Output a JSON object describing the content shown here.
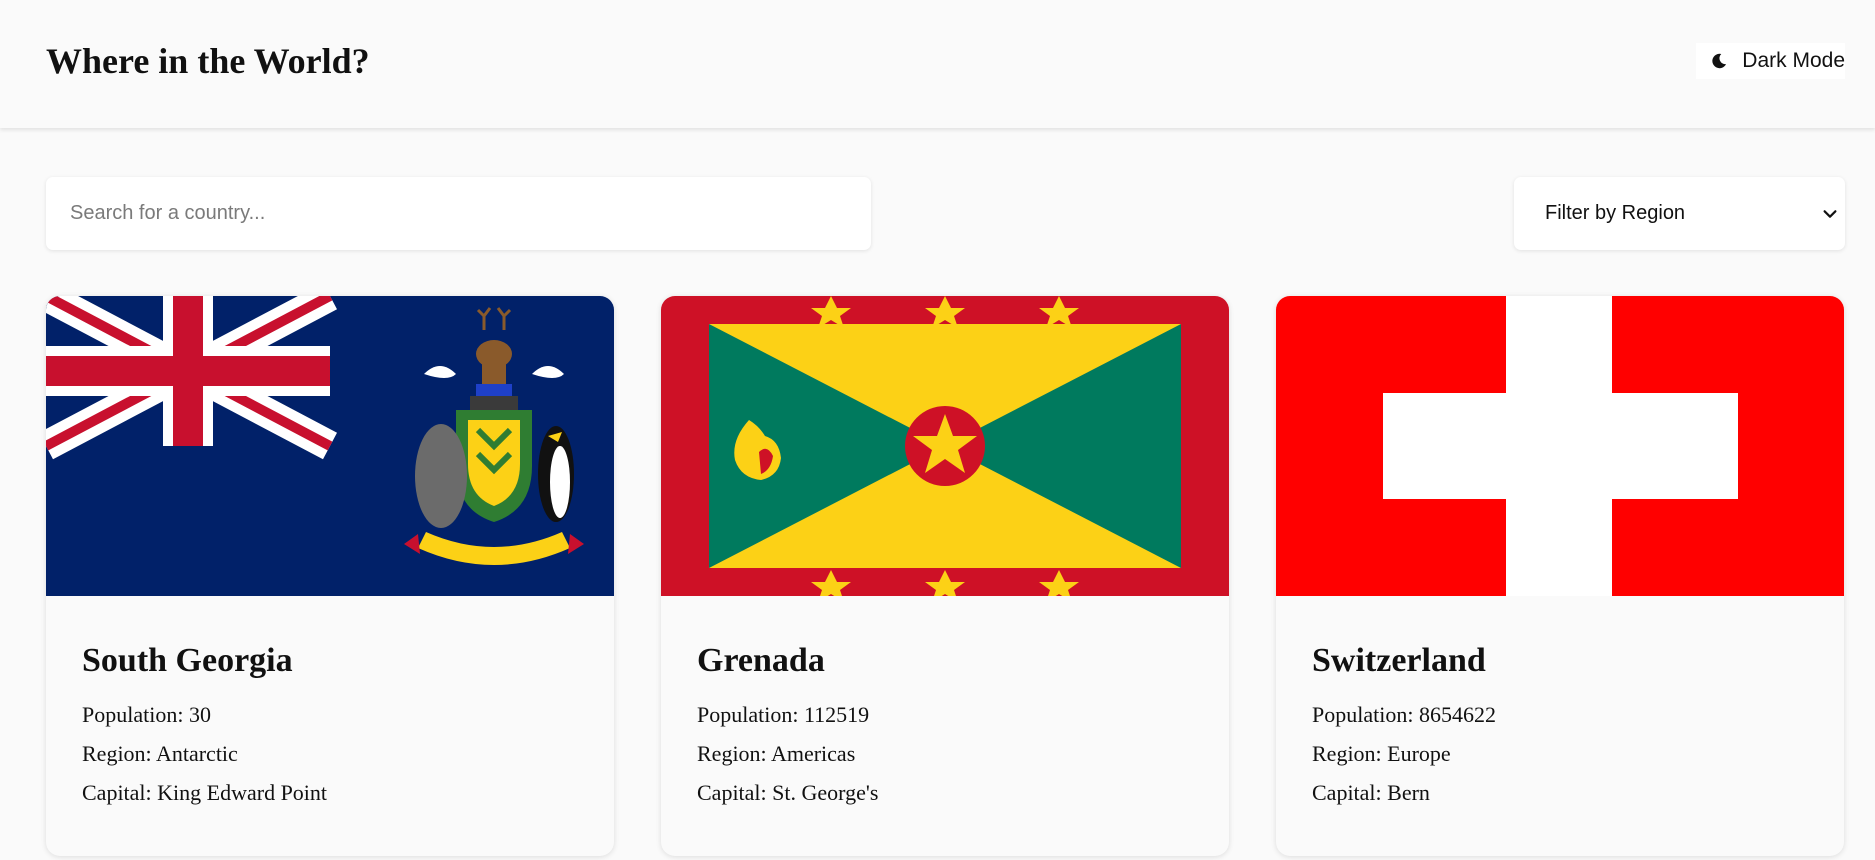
{
  "header": {
    "title": "Where in the World?",
    "dark_mode_label": "Dark Mode",
    "dark_mode_icon": "moon-icon"
  },
  "controls": {
    "search_placeholder": "Search for a country...",
    "search_value": "",
    "search_icon": "none",
    "filter_label": "Filter by Region",
    "filter_icon": "chevron-down-icon"
  },
  "countries": [
    {
      "name": "South Georgia",
      "population_label": "Population:",
      "population": "30",
      "region_label": "Region:",
      "region": "Antarctic",
      "capital_label": "Capital:",
      "capital": "King Edward Point",
      "flag_colors": {
        "field": "#012169",
        "red": "#C8102E",
        "white": "#FFFFFF"
      }
    },
    {
      "name": "Grenada",
      "population_label": "Population:",
      "population": "112519",
      "region_label": "Region:",
      "region": "Americas",
      "capital_label": "Capital:",
      "capital": "St. George's",
      "flag_colors": {
        "red": "#CE1126",
        "yellow": "#FCD116",
        "green": "#007A5E"
      }
    },
    {
      "name": "Switzerland",
      "population_label": "Population:",
      "population": "8654622",
      "region_label": "Region:",
      "region": "Europe",
      "capital_label": "Capital:",
      "capital": "Bern",
      "flag_colors": {
        "red": "#FF0000",
        "white": "#FFFFFF"
      }
    }
  ]
}
